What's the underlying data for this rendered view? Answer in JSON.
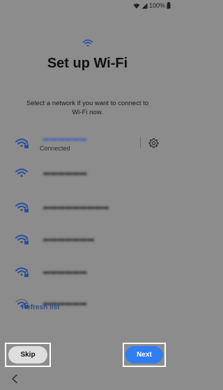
{
  "status_bar": {
    "battery_text": "100%",
    "icons": [
      "wifi-icon",
      "signal-icon",
      "battery-icon"
    ]
  },
  "header": {
    "icon": "wifi-icon",
    "title": "Set up Wi-Fi",
    "subtitle_line1": "Select a network if you want to connect to",
    "subtitle_line2": "Wi-Fi now."
  },
  "networks": [
    {
      "name": "▬▬▬▬▬▬",
      "status": "Connected",
      "secured": true,
      "signal": "full",
      "icon": "wifi-lock-icon"
    },
    {
      "name": "▬▬▬▬▬▬",
      "status": "",
      "secured": false,
      "signal": "full",
      "icon": "wifi-icon"
    },
    {
      "name": "▬▬▬▬▬▬▬▬▬",
      "status": "",
      "secured": true,
      "signal": "full",
      "icon": "wifi-lock-icon"
    },
    {
      "name": "▬▬▬▬▬▬▬",
      "status": "",
      "secured": true,
      "signal": "full",
      "icon": "wifi-lock-icon"
    },
    {
      "name": "▬▬▬▬▬▬",
      "status": "",
      "secured": true,
      "signal": "full",
      "icon": "wifi-lock-icon"
    },
    {
      "name": "▬▬▬▬▬▬",
      "status": "",
      "secured": true,
      "signal": "weak",
      "icon": "wifi-lock-icon"
    }
  ],
  "refresh_label": "Refresh list",
  "buttons": {
    "skip_label": "Skip",
    "next_label": "Next"
  },
  "colors": {
    "background": "#8c8c8c",
    "accent": "#2f7df0",
    "wifi_icon": "#2a4d9e",
    "link": "#2f4f8e"
  }
}
